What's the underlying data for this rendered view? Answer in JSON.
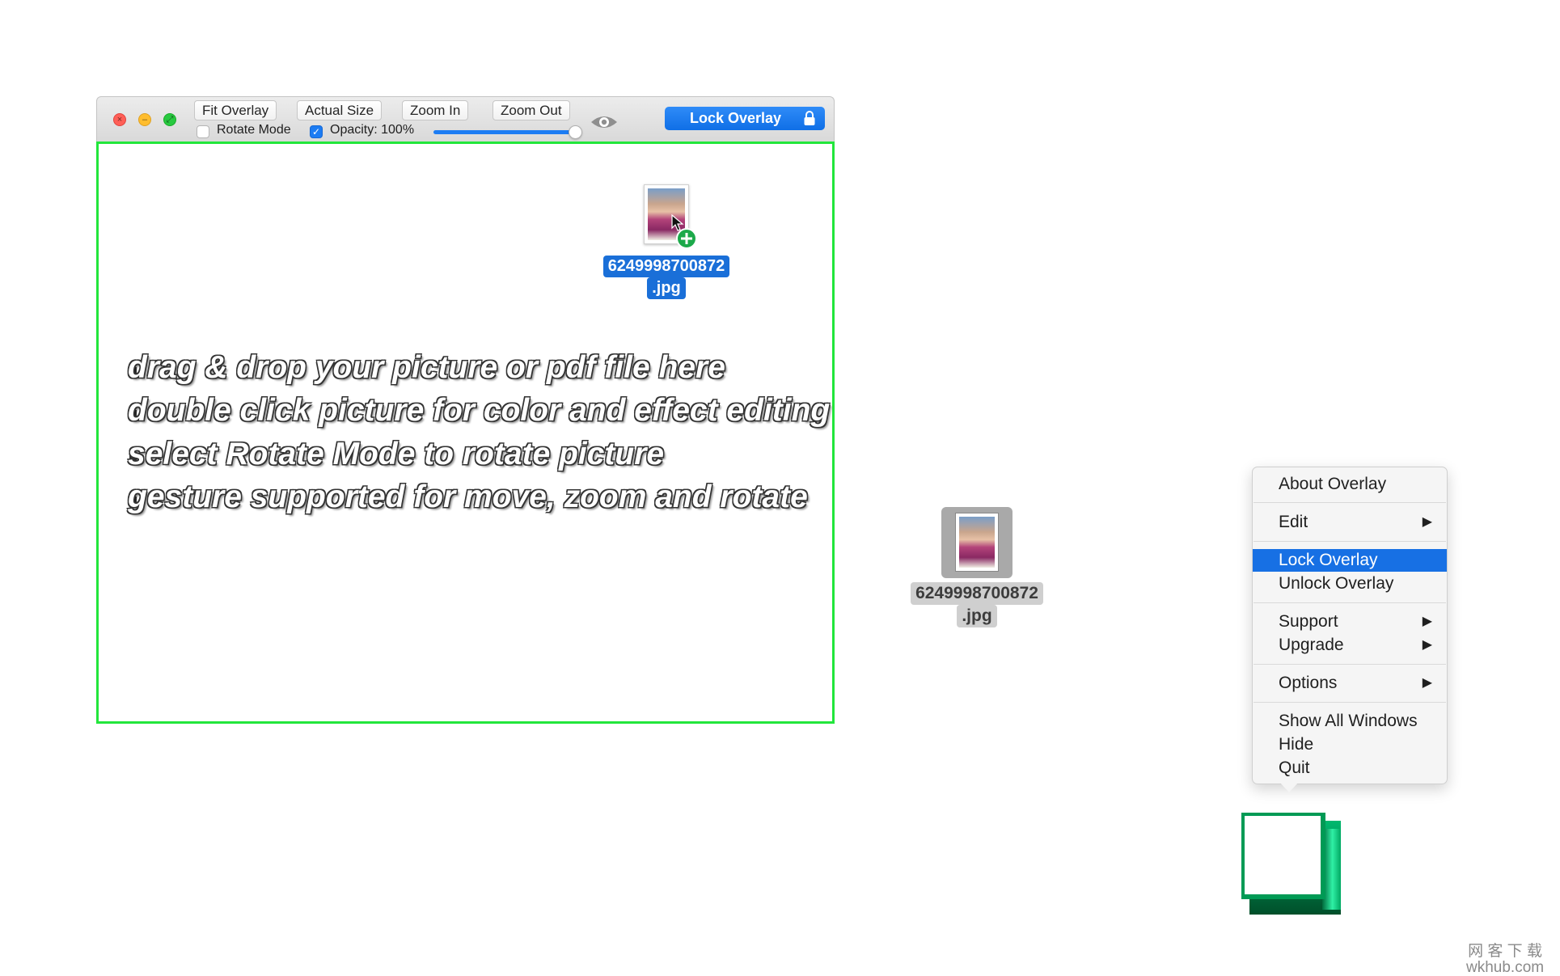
{
  "toolbar": {
    "fit_overlay": "Fit Overlay",
    "actual_size": "Actual Size",
    "zoom_in": "Zoom In",
    "zoom_out": "Zoom Out",
    "rotate_mode_label": "Rotate Mode",
    "rotate_mode_checked": false,
    "opacity_label": "Opacity: 100%",
    "opacity_checked": true,
    "opacity_value": 1.0,
    "lock_overlay": "Lock Overlay"
  },
  "overlay": {
    "border_color": "#22e63b",
    "dragged_file": {
      "name_line1": "6249998700872",
      "name_line2": ".jpg"
    },
    "hints": [
      "drag & drop your picture or pdf file here",
      "double click picture for color and effect editing",
      "select Rotate Mode to rotate picture",
      "gesture supported for move, zoom and rotate"
    ]
  },
  "desktop_file": {
    "name_line1": "6249998700872",
    "name_line2": ".jpg"
  },
  "menu": {
    "items": [
      {
        "label": "About Overlay",
        "submenu": false
      },
      {
        "label": "Edit",
        "submenu": true
      },
      {
        "label": "Lock Overlay",
        "submenu": false,
        "highlighted": true
      },
      {
        "label": "Unlock Overlay",
        "submenu": false
      },
      {
        "label": "Support",
        "submenu": true
      },
      {
        "label": "Upgrade",
        "submenu": true
      },
      {
        "label": "Options",
        "submenu": true
      },
      {
        "label": "Show All Windows",
        "submenu": false
      },
      {
        "label": "Hide",
        "submenu": false
      },
      {
        "label": "Quit",
        "submenu": false
      }
    ]
  },
  "watermark": {
    "line1": "网 客 下 载",
    "line2": "wkhub.com"
  },
  "colors": {
    "accent": "#1770e4",
    "window_border": "#22e63b",
    "menubar_icon": "#00c06a"
  }
}
